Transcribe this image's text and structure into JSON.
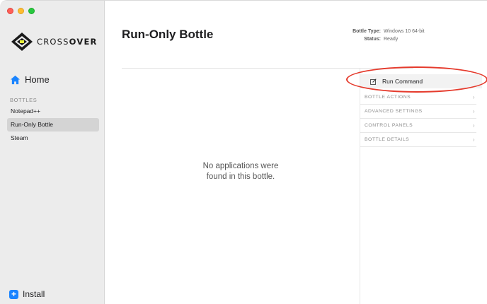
{
  "window": {
    "controls": [
      "close",
      "minimize",
      "zoom"
    ]
  },
  "sidebar": {
    "logo": {
      "part1": "CROSS",
      "part2": "OVER",
      "icon": "crossover-logo-icon"
    },
    "home_label": "Home",
    "section_label": "BOTTLES",
    "bottles": [
      {
        "label": "Notepad++",
        "selected": false
      },
      {
        "label": "Run-Only Bottle",
        "selected": true
      },
      {
        "label": "Steam",
        "selected": false
      }
    ],
    "install_label": "Install"
  },
  "main": {
    "title": "Run-Only Bottle",
    "meta": {
      "type_key": "Bottle Type:",
      "type_value": "Windows 10 64-bit",
      "status_key": "Status:",
      "status_value": "Ready"
    },
    "empty_message_line1": "No applications were",
    "empty_message_line2": "found in this bottle."
  },
  "panel": {
    "run_command_label": "Run Command",
    "sections": [
      {
        "label": "BOTTLE ACTIONS"
      },
      {
        "label": "ADVANCED SETTINGS"
      },
      {
        "label": "CONTROL PANELS"
      },
      {
        "label": "BOTTLE DETAILS"
      }
    ]
  },
  "colors": {
    "accent": "#1a84ff",
    "highlight": "#e53a2c",
    "sidebar_bg": "#ececec",
    "selected_bg": "#d4d4d4"
  }
}
